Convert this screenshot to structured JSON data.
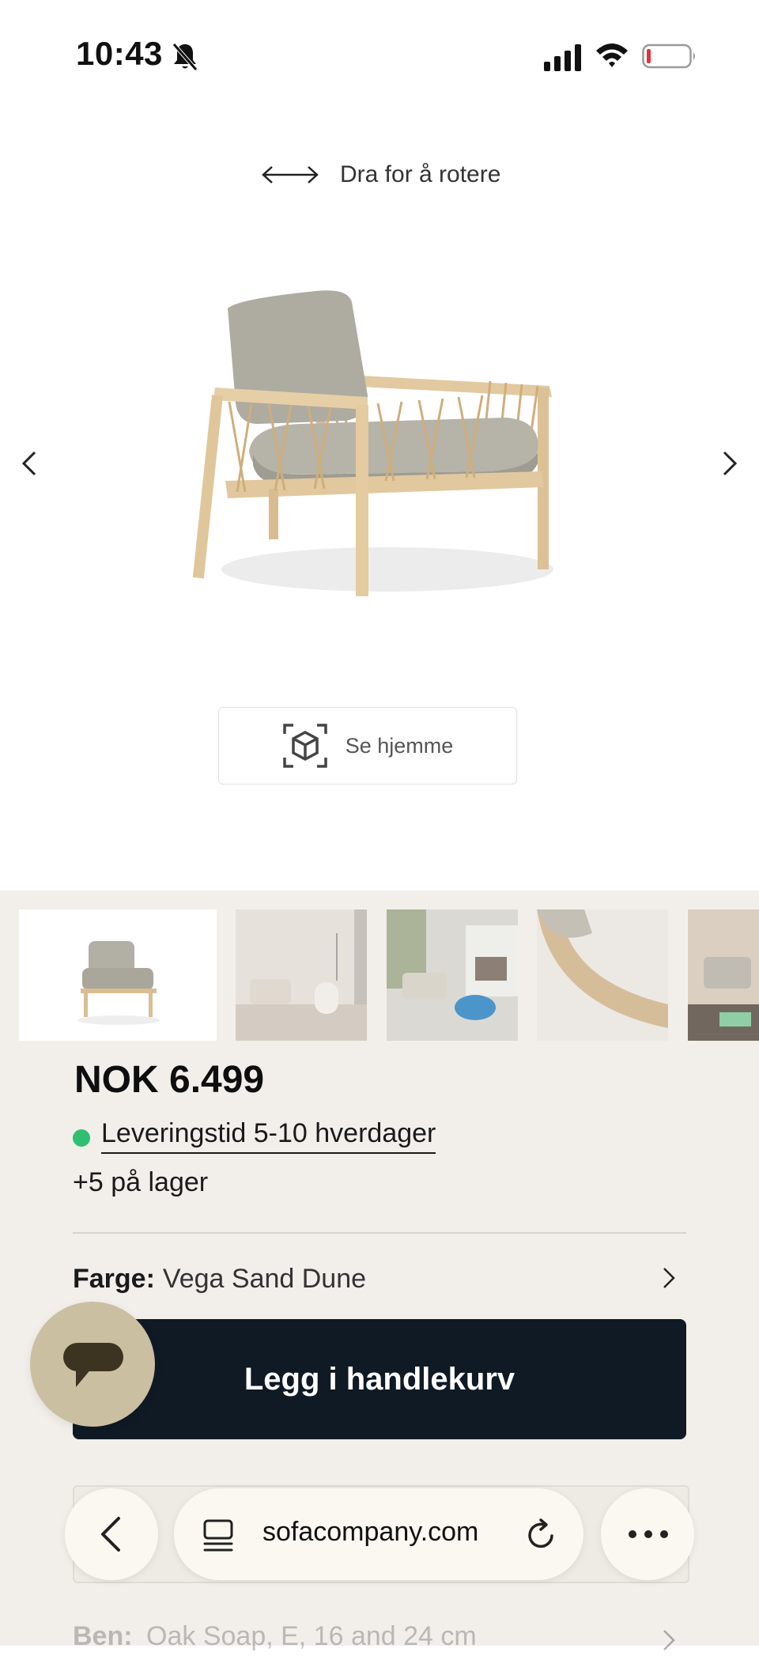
{
  "status_bar": {
    "time": "10:43"
  },
  "viewer": {
    "rotate_hint": "Dra for å rotere",
    "ar_button_label": "Se hjemme"
  },
  "product": {
    "price": "NOK 6.499",
    "delivery": "Leveringstid 5-10 hverdager",
    "stock": "+5 på lager",
    "color_label": "Farge:",
    "color_value": "Vega Sand Dune",
    "add_to_cart_label": "Legg i handlekurv",
    "legs_label": "Ben:",
    "legs_value": "Oak Soap, E, 16 and 24 cm"
  },
  "browser": {
    "address": "sofacompany.com"
  },
  "colors": {
    "accent_dark": "#101a24",
    "panel_bg": "#f2efea",
    "in_stock_green": "#2fbf71",
    "chat_bubble": "#cbbfa2"
  }
}
